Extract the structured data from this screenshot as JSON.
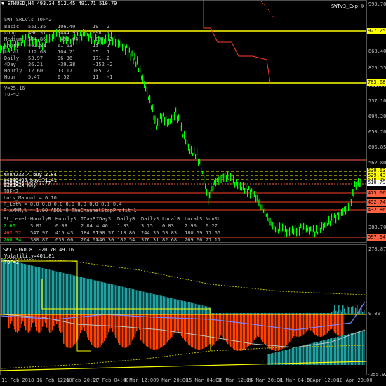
{
  "header": {
    "symbol_line": "ETHUSD,H4  493.34 512.45 491.71 510.79",
    "expert": "SWTv3_Exp ☺"
  },
  "info_panel": {
    "title": "SWT_SRLvls_TOF=2",
    "rows": [
      [
        "Basic",
        "551.35",
        "106.40",
        "19",
        "2"
      ],
      [
        "Long",
        "406.51",
        "-444.95",
        "-98",
        "-1"
      ],
      [
        "Medium",
        "554.86",
        "-493.04",
        "-89",
        "-2"
      ],
      [
        "Short",
        "401.81",
        "61.63",
        "15",
        "1"
      ],
      [
        "Local",
        "112.68",
        "104.21",
        "55",
        "1"
      ],
      [
        "Daily",
        "53.97",
        "96.36",
        "171",
        "2"
      ],
      [
        "4Day",
        "26.21",
        "-39.38",
        "-152",
        "-2"
      ],
      [
        "Hourly",
        "12.60",
        "13.17",
        "105",
        "2"
      ],
      [
        "Hour",
        "5.47",
        "0.52",
        "11",
        "-1"
      ]
    ],
    "v_line": "V=25.16",
    "tof_line": "TOF=2"
  },
  "trade_panel": {
    "lines": [
      "#484732 4 buy 2.84",
      "#4848499 buy 31.41",
      "#484848 buy 7.77",
      "#484848 buy",
      "TOF=2",
      "Lots_Manual = 0.10",
      "R_Lot% = 0.0    0.0    0.0    0.0    0.0    0.0    0.1    0.4",
      "R_AMMM,% = 1.00       ADDL=0         TheChannelStopProfit=1"
    ],
    "table_header": [
      "SL_Level:",
      "HourlyB",
      "HourlyS",
      "IDayB",
      "IDayS",
      "DailyB",
      "DailyS",
      "LocalB",
      "LocalS",
      "NonSL"
    ],
    "table_rows": [
      [
        "2.60",
        "3.81",
        "6.38",
        "2.84",
        "4.46",
        "1.83",
        "3.75",
        "0.83",
        "2.90",
        "0.27"
      ],
      [
        "462.52",
        "547.97",
        "415.43",
        "184.91",
        "290.57",
        "118.86",
        "244.35",
        "53.83",
        "180.59",
        "17.65"
      ],
      [
        "260.34",
        "380.87",
        "633.06",
        "264.01",
        "446.30",
        "182.54",
        "376.31",
        "82.68",
        "269.66",
        "27.11"
      ]
    ],
    "table_row_colors": [
      "#00ff00",
      "#ff4040",
      "#00ff00"
    ]
  },
  "price_axis": {
    "ticks": [
      "999.70",
      "912.25",
      "868.40",
      "825.55",
      "781.60",
      "737.10",
      "694.20",
      "650.70",
      "606.85",
      "562.80",
      "519.60",
      "475.25",
      "432.40",
      "388.70",
      "345.20"
    ],
    "boxes": [
      {
        "label": "927.25",
        "color": "#ffff00"
      },
      {
        "label": "783.68",
        "color": "#ffff00"
      },
      {
        "label": "539.63",
        "color": "#ffff00"
      },
      {
        "label": "529.43",
        "color": "#ffff00"
      },
      {
        "label": "518.19",
        "color": "#ffff00"
      },
      {
        "label": "510.79",
        "color": "#ffffff"
      },
      {
        "label": "475.66",
        "color": "#ff6040"
      },
      {
        "label": "452.74",
        "color": "#ff6040"
      },
      {
        "label": "432.86",
        "color": "#ff6040"
      },
      {
        "label": "357.54",
        "color": "#ff6040"
      }
    ]
  },
  "indicator": {
    "title_line": "SWT -160.81 -20.70 49.16",
    "volatility": "Volatility=401.81",
    "tof": "TOF=2",
    "ticks": [
      "278.87",
      "0.00",
      "-255.92"
    ]
  },
  "time_axis": {
    "ticks": [
      "11 Feb 2018",
      "16 Feb 12:00",
      "21 Feb 20:00",
      "27 Feb 04:00",
      "4 Mar 12:00",
      "9 Mar 20:00",
      "15 Mar 04:00",
      "20 Mar 12:00",
      "25 Mar 20:00",
      "31 Mar 04:00",
      "5 Apr 12:00",
      "10 Apr 20:00"
    ]
  },
  "colors": {
    "background": "#000000",
    "candles": "#00ff00",
    "support": "#ff4020",
    "resistance": "#ffff00",
    "histogram_teal": "#20a0a0",
    "histogram_red": "#ff4000",
    "grid": "#303030"
  }
}
